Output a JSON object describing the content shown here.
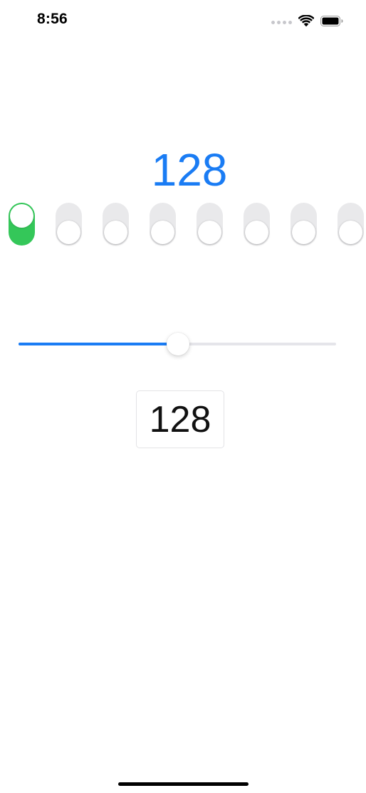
{
  "status_bar": {
    "time": "8:56",
    "icons": [
      "signal-dots-icon",
      "wifi-icon",
      "battery-icon"
    ]
  },
  "display": {
    "value": "128",
    "color": "#1a7cf4"
  },
  "switches": [
    {
      "name": "bit-switch-1",
      "on": true
    },
    {
      "name": "bit-switch-2",
      "on": false
    },
    {
      "name": "bit-switch-3",
      "on": false
    },
    {
      "name": "bit-switch-4",
      "on": false
    },
    {
      "name": "bit-switch-5",
      "on": false
    },
    {
      "name": "bit-switch-6",
      "on": false
    },
    {
      "name": "bit-switch-7",
      "on": false
    },
    {
      "name": "bit-switch-8",
      "on": false
    }
  ],
  "slider": {
    "min": 0,
    "max": 255,
    "value": 128,
    "accent": "#1a7cf4"
  },
  "value_field": {
    "value": "128"
  },
  "colors": {
    "switch_on": "#34c759",
    "switch_off": "#e9e9eb"
  }
}
